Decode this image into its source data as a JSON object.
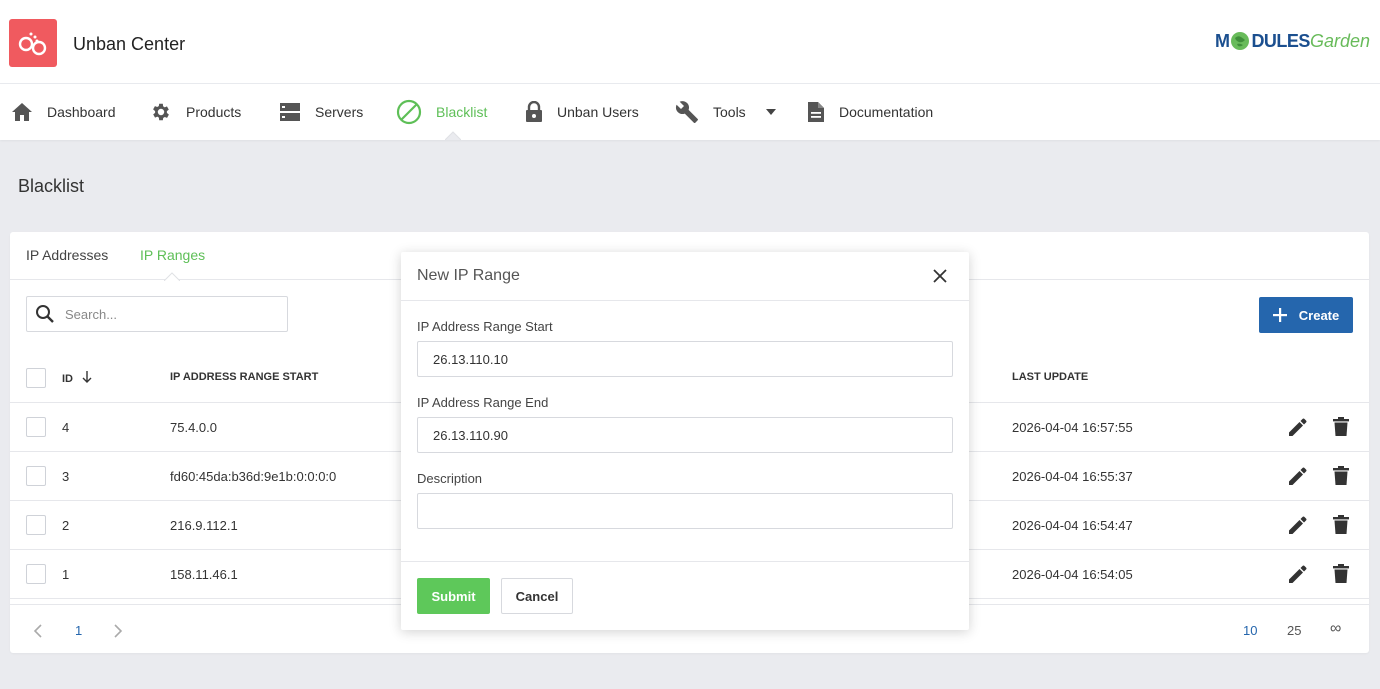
{
  "header": {
    "app_title": "Unban Center",
    "brand_part1": "M",
    "brand_part2": "DULES",
    "brand_part3": "Garden"
  },
  "nav": {
    "items": [
      {
        "label": "Dashboard",
        "icon": "home-icon"
      },
      {
        "label": "Products",
        "icon": "gear-icon"
      },
      {
        "label": "Servers",
        "icon": "server-icon"
      },
      {
        "label": "Blacklist",
        "icon": "block-icon",
        "active": true
      },
      {
        "label": "Unban Users",
        "icon": "lock-icon"
      },
      {
        "label": "Tools",
        "icon": "wrench-icon",
        "dropdown": true
      },
      {
        "label": "Documentation",
        "icon": "document-icon"
      }
    ]
  },
  "page": {
    "title": "Blacklist"
  },
  "tabs": [
    {
      "label": "IP Addresses",
      "active": false
    },
    {
      "label": "IP Ranges",
      "active": true
    }
  ],
  "search": {
    "placeholder": "Search..."
  },
  "toolbar": {
    "create_label": "Create"
  },
  "table": {
    "columns": {
      "id": "ID",
      "range_start": "IP ADDRESS RANGE START",
      "last_update": "LAST UPDATE"
    },
    "rows": [
      {
        "id": "4",
        "range_start": "75.4.0.0",
        "last_update": "2026-04-04 16:57:55"
      },
      {
        "id": "3",
        "range_start": "fd60:45da:b36d:9e1b:0:0:0:0",
        "last_update": "2026-04-04 16:55:37"
      },
      {
        "id": "2",
        "range_start": "216.9.112.1",
        "last_update": "2026-04-04 16:54:47"
      },
      {
        "id": "1",
        "range_start": "158.11.46.1",
        "last_update": "2026-04-04 16:54:05"
      }
    ]
  },
  "pagination": {
    "current_page": "1",
    "page_sizes": [
      "10",
      "25",
      "∞"
    ],
    "selected_size": "10"
  },
  "modal": {
    "title": "New IP Range",
    "range_start_label": "IP Address Range Start",
    "range_start_value": "26.13.110.10",
    "range_end_label": "IP Address Range End",
    "range_end_value": "26.13.110.90",
    "description_label": "Description",
    "description_value": "",
    "submit_label": "Submit",
    "cancel_label": "Cancel"
  },
  "colors": {
    "accent_green": "#5ebf57",
    "primary_blue": "#2566ad",
    "logo_red": "#f05a5f",
    "background": "#eaebef"
  }
}
